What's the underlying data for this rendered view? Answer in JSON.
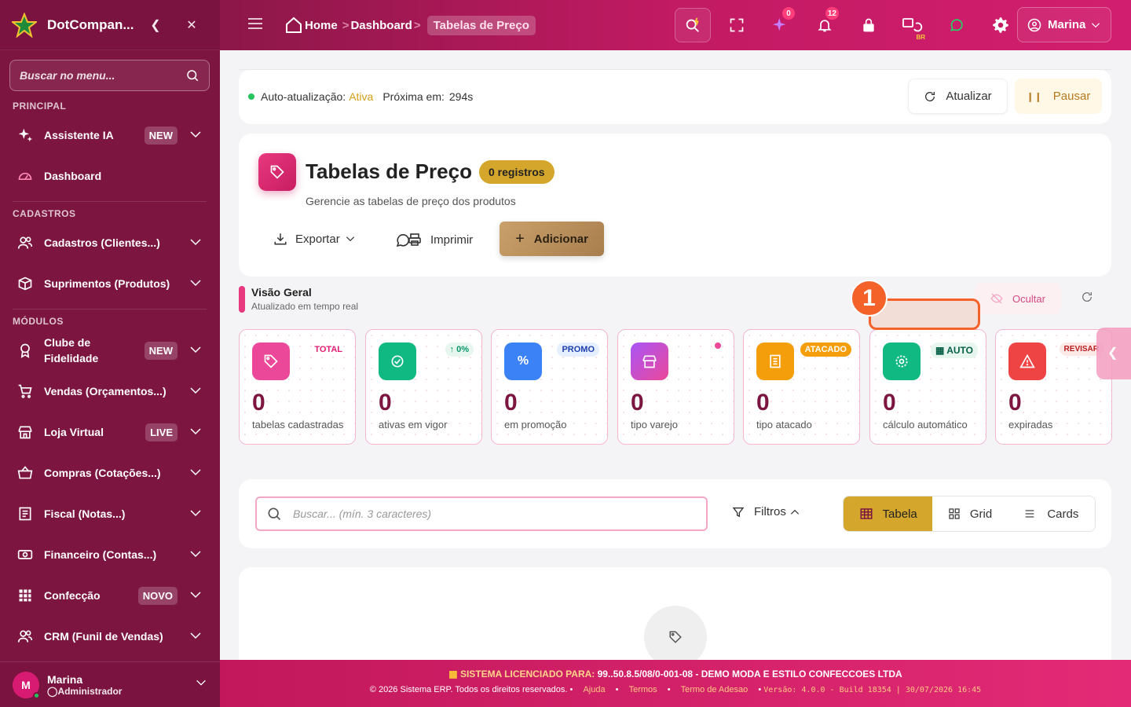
{
  "sidebar": {
    "app_name": "DotCompan...",
    "search_placeholder": "Buscar no menu...",
    "sections": {
      "principal": "PRINCIPAL",
      "cadastros": "CADASTROS",
      "modulos": "MÓDULOS"
    },
    "items": [
      {
        "label": "Assistente IA",
        "badge": "NEW",
        "icon": "sparkle-icon"
      },
      {
        "label": "Dashboard",
        "badge": "",
        "icon": "gauge-icon"
      },
      {
        "label": "Cadastros (Clientes...)",
        "badge": "",
        "icon": "users-icon"
      },
      {
        "label": "Suprimentos (Produtos)",
        "badge": "",
        "icon": "box-icon"
      },
      {
        "label": "Clube de Fidelidade",
        "badge": "NEW",
        "icon": "medal-icon"
      },
      {
        "label": "Vendas (Orçamentos...)",
        "badge": "",
        "icon": "cart-icon"
      },
      {
        "label": "Loja Virtual",
        "badge": "LIVE",
        "icon": "store-icon"
      },
      {
        "label": "Compras (Cotações...)",
        "badge": "",
        "icon": "basket-icon"
      },
      {
        "label": "Fiscal (Notas...)",
        "badge": "",
        "icon": "receipt-icon"
      },
      {
        "label": "Financeiro (Contas...)",
        "badge": "",
        "icon": "cash-icon"
      },
      {
        "label": "Confecção",
        "badge": "NOVO",
        "icon": "grid-icon"
      },
      {
        "label": "CRM (Funil de Vendas)",
        "badge": "",
        "icon": "users-icon"
      }
    ],
    "user": {
      "initial": "M",
      "name": "Marina",
      "role": "Administrador"
    }
  },
  "topbar": {
    "home": "Home",
    "crumb": "Dashboard",
    "current": "Tabelas de Preço",
    "ai_badge": "0",
    "notif_badge": "12",
    "lang": "BR",
    "user": "Marina"
  },
  "autoupdate": {
    "label": "Auto-atualização:",
    "status": "Ativa",
    "next_label": "Próxima em:",
    "next_value": "294s",
    "refresh": "Atualizar",
    "pause": "Pausar"
  },
  "header": {
    "title": "Tabelas de Preço",
    "count": "0 registros",
    "subtitle": "Gerencie as tabelas de preço dos produtos",
    "export": "Exportar",
    "print": "Imprimir",
    "add": "Adicionar"
  },
  "overview": {
    "title": "Visão Geral",
    "subtitle": "Atualizado em tempo real",
    "hide": "Ocultar",
    "marker": "1"
  },
  "stats": [
    {
      "value": "0",
      "label": "tabelas cadastradas",
      "tag": "TOTAL",
      "icon": "tag-icon",
      "color": "#ec4899"
    },
    {
      "value": "0",
      "label": "ativas em vigor",
      "tag": "0%",
      "icon": "check-circle-icon",
      "color": "#10b981"
    },
    {
      "value": "0",
      "label": "em promoção",
      "tag": "PROMO",
      "icon": "percent-icon",
      "color": "#3b82f6"
    },
    {
      "value": "0",
      "label": "tipo varejo",
      "tag": "",
      "icon": "shop-icon",
      "color": "#a855f7"
    },
    {
      "value": "0",
      "label": "tipo atacado",
      "tag": "ATACADO",
      "icon": "building-icon",
      "color": "#f59e0b"
    },
    {
      "value": "0",
      "label": "cálculo automático",
      "tag": "AUTO",
      "icon": "gear-icon",
      "color": "#10b981"
    },
    {
      "value": "0",
      "label": "expiradas",
      "tag": "REVISAR",
      "icon": "warning-icon",
      "color": "#ef4444"
    }
  ],
  "search": {
    "placeholder": "Buscar... (mín. 3 caracteres)",
    "filters": "Filtros",
    "views": [
      "Tabela",
      "Grid",
      "Cards"
    ]
  },
  "footer": {
    "license_label": "SISTEMA LICENCIADO PARA:",
    "license_value": "99..50.8.5/08/0-001-08 - DEMO MODA E ESTILO CONFECCOES LTDA",
    "copyright": "© 2026 Sistema ERP. Todos os direitos reservados.",
    "links": [
      "Ajuda",
      "Termos",
      "Termo de Adesao"
    ],
    "version": "Versão: 4.0.0 - Build 18354 | 30/07/2026 16:45"
  }
}
